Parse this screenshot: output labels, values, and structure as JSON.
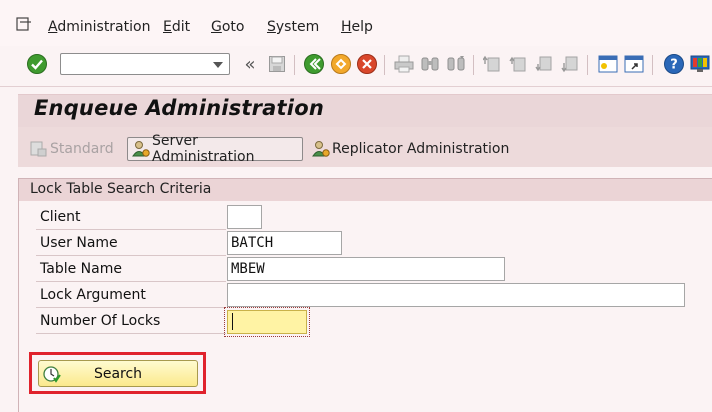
{
  "menu": {
    "items": [
      {
        "first": "A",
        "rest": "dministration"
      },
      {
        "first": "E",
        "rest": "dit"
      },
      {
        "first": "G",
        "rest": "oto"
      },
      {
        "first": "S",
        "rest": "ystem"
      },
      {
        "first": "H",
        "rest": "elp"
      }
    ]
  },
  "toolbar": {
    "command_field": {
      "value": "",
      "placeholder": ""
    },
    "icons": [
      "enter-icon",
      "back-icon",
      "save-icon",
      "exit-icon",
      "cancel-icon",
      "print-icon",
      "find-icon",
      "find-next-icon",
      "first-page-icon",
      "previous-page-icon",
      "next-page-icon",
      "last-page-icon",
      "new-session-icon",
      "shortcut-icon",
      "help-icon",
      "layout-icon"
    ]
  },
  "page": {
    "title": "Enqueue Administration"
  },
  "app_toolbar": {
    "standard_label": "Standard",
    "server_admin_label": "Server Administration",
    "replicator_admin_label": "Replicator Administration"
  },
  "search_criteria": {
    "title": "Lock Table Search Criteria",
    "client_label": "Client",
    "client_value": "",
    "user_name_label": "User Name",
    "user_name_value": "BATCH",
    "table_name_label": "Table Name",
    "table_name_value": "MBEW",
    "lock_argument_label": "Lock Argument",
    "lock_argument_value": "",
    "number_of_locks_label": "Number Of Locks",
    "number_of_locks_value": ""
  },
  "search_button": {
    "label": "Search"
  },
  "colors": {
    "accent_highlight": "#e0222c",
    "focus_field": "#fff3a4",
    "background": "#fbf3f4"
  }
}
